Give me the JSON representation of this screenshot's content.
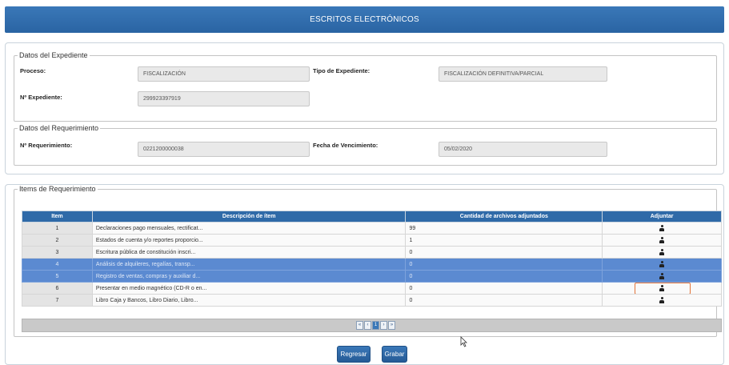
{
  "header": {
    "title": "ESCRITOS ELECTRÓNICOS"
  },
  "expediente": {
    "legend": "Datos del Expediente",
    "proceso_label": "Proceso:",
    "proceso_value": "FISCALIZACIÓN",
    "tipo_label": "Tipo de Expediente:",
    "tipo_value": "FISCALIZACIÓN DEFINITIVA/PARCIAL",
    "numero_label": "Nº Expediente:",
    "numero_value": "299923397919"
  },
  "requerimiento": {
    "legend": "Datos del Requerimiento",
    "numero_label": "Nº Requerimiento:",
    "numero_value": "0221200000038",
    "fecha_label": "Fecha de Vencimiento:",
    "fecha_value": "05/02/2020"
  },
  "items": {
    "legend": "Items de Requerimiento",
    "columns": [
      "Item",
      "Descripción de ítem",
      "Cantidad de archivos adjuntados",
      "Adjuntar"
    ],
    "rows": [
      {
        "item": "1",
        "descripcion": "Declaraciones pago mensuales, rectificat...",
        "cantidad": "99",
        "selected": false,
        "focused": false
      },
      {
        "item": "2",
        "descripcion": "Estados de cuenta y/o reportes proporcio...",
        "cantidad": "1",
        "selected": false,
        "focused": false
      },
      {
        "item": "3",
        "descripcion": "Escritura pública de constitución inscri...",
        "cantidad": "0",
        "selected": false,
        "focused": false
      },
      {
        "item": "4",
        "descripcion": "Análisis de alquileres, regalías, transp...",
        "cantidad": "0",
        "selected": true,
        "focused": false
      },
      {
        "item": "5",
        "descripcion": "Registro de ventas, compras y auxiliar d...",
        "cantidad": "0",
        "selected": true,
        "focused": false
      },
      {
        "item": "6",
        "descripcion": "Presentar en medio magnético (CD-R o en...",
        "cantidad": "0",
        "selected": false,
        "focused": true
      },
      {
        "item": "7",
        "descripcion": "Libro Caja y Bancos, Libro Diario, Libro...",
        "cantidad": "0",
        "selected": false,
        "focused": false
      }
    ],
    "pager": {
      "first": "«",
      "prev": "‹",
      "page": "1",
      "next": "›",
      "last": "»"
    },
    "attach_icon": "person-icon"
  },
  "buttons": {
    "regresar": "Regresar",
    "grabar": "Grabar"
  },
  "colors": {
    "accent": "#2f6aa8",
    "selected_row": "#5b8ad1",
    "focus": "#e2743a"
  }
}
